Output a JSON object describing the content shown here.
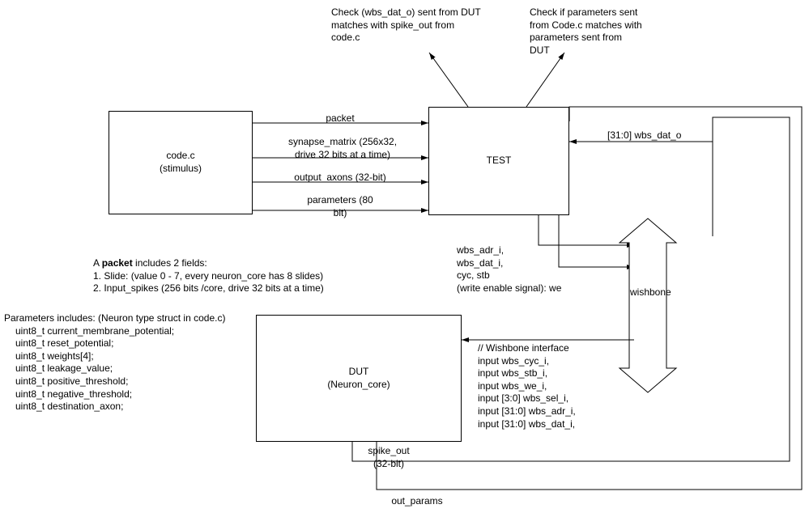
{
  "boxes": {
    "codec": {
      "line1": "code.c",
      "line2": "(stimulus)"
    },
    "test": {
      "line1": "TEST"
    },
    "dut": {
      "line1": "DUT",
      "line2": "(Neuron_core)"
    }
  },
  "arrows": {
    "packet": "packet",
    "synapse_matrix": "synapse_matrix (256x32,\ndrive 32 bits at a time)",
    "output_axons": "output_axons (32-bit)",
    "parameters": "parameters (80\nbit)",
    "wbs_dat_o": "[31:0] wbs_dat_o",
    "spike_out": "spike_out\n(32-bit)",
    "out_params": "out_params",
    "wishbone": "wishbone"
  },
  "checks": {
    "check_left": "Check (wbs_dat_o) sent from DUT\nmatches with spike_out from\ncode.c",
    "check_right": "Check if parameters sent\nfrom Code.c matches with\nparameters sent from\nDUT"
  },
  "signals_out": "wbs_adr_i,\nwbs_dat_i,\ncyc, stb\n(write enable signal): we",
  "wishbone_iface": "// Wishbone interface\ninput  wbs_cyc_i,\ninput  wbs_stb_i,\ninput  wbs_we_i,\ninput  [3:0] wbs_sel_i,\ninput  [31:0] wbs_adr_i,\ninput  [31:0] wbs_dat_i,",
  "packet_note": {
    "prefix": "A ",
    "bold": "packet",
    "suffix": " includes 2 fields:",
    "line1": "1. Slide: (value 0 - 7, every neuron_core has 8 slides)",
    "line2": "2. Input_spikes (256 bits /core, drive 32 bits at a time)"
  },
  "params_note": {
    "title": "Parameters includes: (Neuron type struct in code.c)",
    "l1": "uint8_t current_membrane_potential;",
    "l2": "uint8_t reset_potential;",
    "l3": "uint8_t weights[4];",
    "l4": "uint8_t leakage_value;",
    "l5": "uint8_t positive_threshold;",
    "l6": "uint8_t negative_threshold;",
    "l7": "uint8_t destination_axon;"
  },
  "chart_data": {
    "type": "diagram",
    "nodes": [
      {
        "id": "codec",
        "label": "code.c (stimulus)"
      },
      {
        "id": "test",
        "label": "TEST"
      },
      {
        "id": "dut",
        "label": "DUT (Neuron_core)"
      },
      {
        "id": "wishbone",
        "label": "wishbone"
      }
    ],
    "edges": [
      {
        "from": "codec",
        "to": "test",
        "label": "packet"
      },
      {
        "from": "codec",
        "to": "test",
        "label": "synapse_matrix (256x32, drive 32 bits at a time)"
      },
      {
        "from": "codec",
        "to": "test",
        "label": "output_axons (32-bit)"
      },
      {
        "from": "codec",
        "to": "test",
        "label": "parameters (80 bit)"
      },
      {
        "from": "test",
        "to": "wishbone",
        "label": "wbs_adr_i, wbs_dat_i, cyc, stb, (write enable signal): we"
      },
      {
        "from": "wishbone",
        "to": "dut",
        "label": "// Wishbone interface inputs"
      },
      {
        "from": "dut",
        "to": "test",
        "label": "[31:0] wbs_dat_o",
        "via": "right"
      },
      {
        "from": "dut",
        "to": "test",
        "label": "spike_out (32-bit)",
        "via": "bottom-right"
      },
      {
        "from": "dut",
        "to": "test",
        "label": "out_params",
        "via": "bottom-right"
      }
    ],
    "annotations": [
      "Check (wbs_dat_o) sent from DUT matches with spike_out from code.c",
      "Check if parameters sent from Code.c matches with parameters sent from DUT"
    ]
  }
}
